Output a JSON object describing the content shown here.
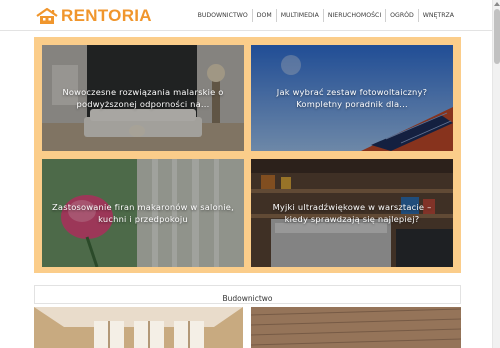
{
  "brand": {
    "name": "RENTORIA",
    "color": "#f0962d"
  },
  "nav": {
    "items": [
      "Budownictwo",
      "Dom",
      "Multimedia",
      "Nieruchomości",
      "Ogród",
      "Wnętrza"
    ]
  },
  "featured": {
    "border_color": "#fbcd8a",
    "tiles": [
      {
        "title": "Nowoczesne rozwiązania malarskie o podwyższonej odporności na..."
      },
      {
        "title": "Jak wybrać zestaw fotowoltaiczny? Kompletny poradnik dla..."
      },
      {
        "title": "Zastosowanie firan makaronów w salonie, kuchni i przedpokoju"
      },
      {
        "title": "Myjki ultradźwiękowe w warsztacie – kiedy sprawdzają się najlepiej?"
      }
    ]
  },
  "section": {
    "title": "Budownictwo"
  }
}
